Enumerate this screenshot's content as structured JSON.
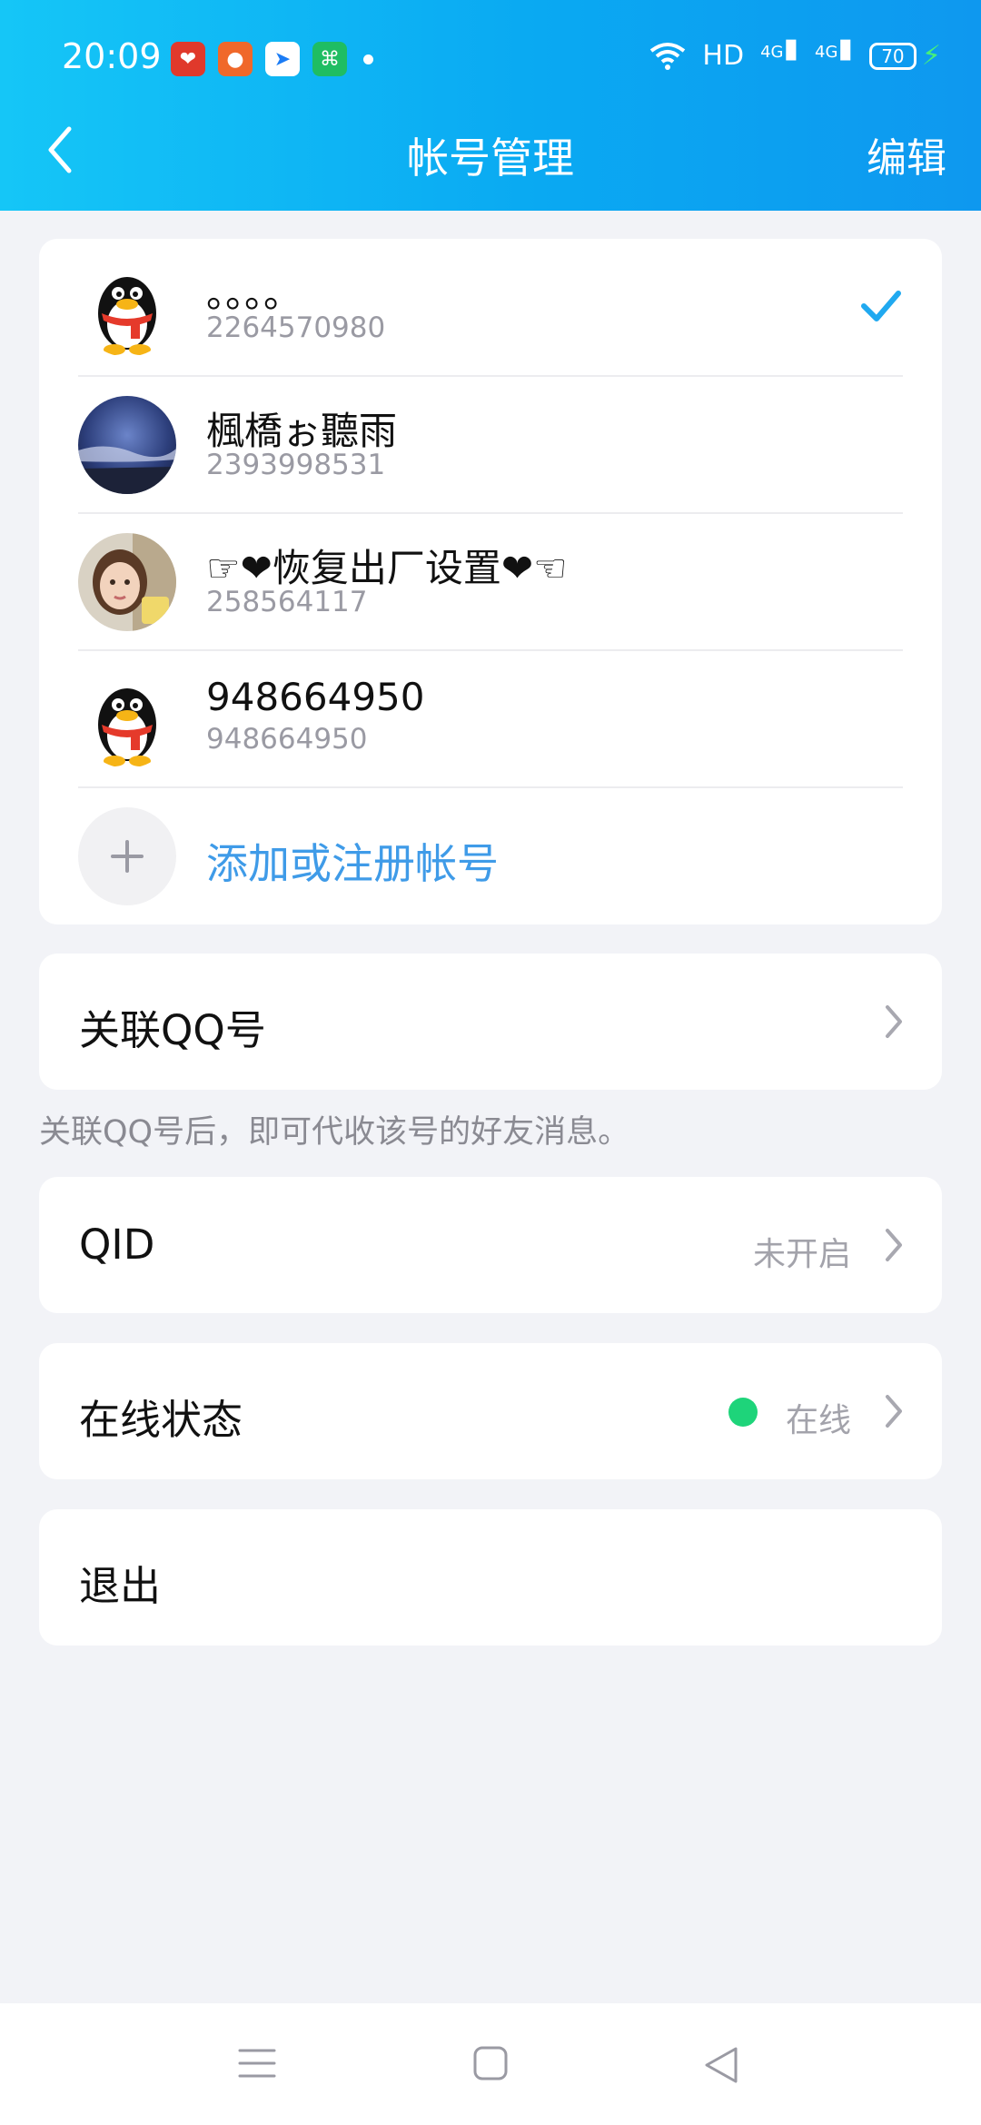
{
  "status_bar": {
    "time": "20:09",
    "network": "HD",
    "signal1": "4G",
    "signal2": "4G",
    "battery": "70"
  },
  "nav": {
    "title": "帐号管理",
    "edit_label": "编辑"
  },
  "accounts": [
    {
      "name": "。。。。",
      "number": "2264570980",
      "avatar": "penguin-avatar",
      "selected": true
    },
    {
      "name": "楓橋ぉ聽雨",
      "number": "2393998531",
      "avatar": "sky-photo-avatar",
      "selected": false
    },
    {
      "name": "☞❤恢复出厂设置❤☜",
      "number": "258564117",
      "avatar": "girl-photo-avatar",
      "selected": false
    },
    {
      "name": "948664950",
      "number": "948664950",
      "avatar": "penguin-avatar",
      "selected": false
    }
  ],
  "add_account": {
    "label": "添加或注册帐号"
  },
  "options": {
    "link_qq": {
      "label": "关联QQ号"
    },
    "link_note": "关联QQ号后，即可代收该号的好友消息。",
    "qid": {
      "label": "QID",
      "value": "未开启"
    },
    "online": {
      "label": "在线状态",
      "value": "在线"
    },
    "logout": {
      "label": "退出"
    }
  },
  "colors": {
    "header_start": "#15c6f7",
    "header_end": "#0e98ef",
    "accent_link": "#3f9be8",
    "check": "#20a9f0",
    "online_dot": "#1ed47a",
    "background": "#f2f3f7"
  }
}
